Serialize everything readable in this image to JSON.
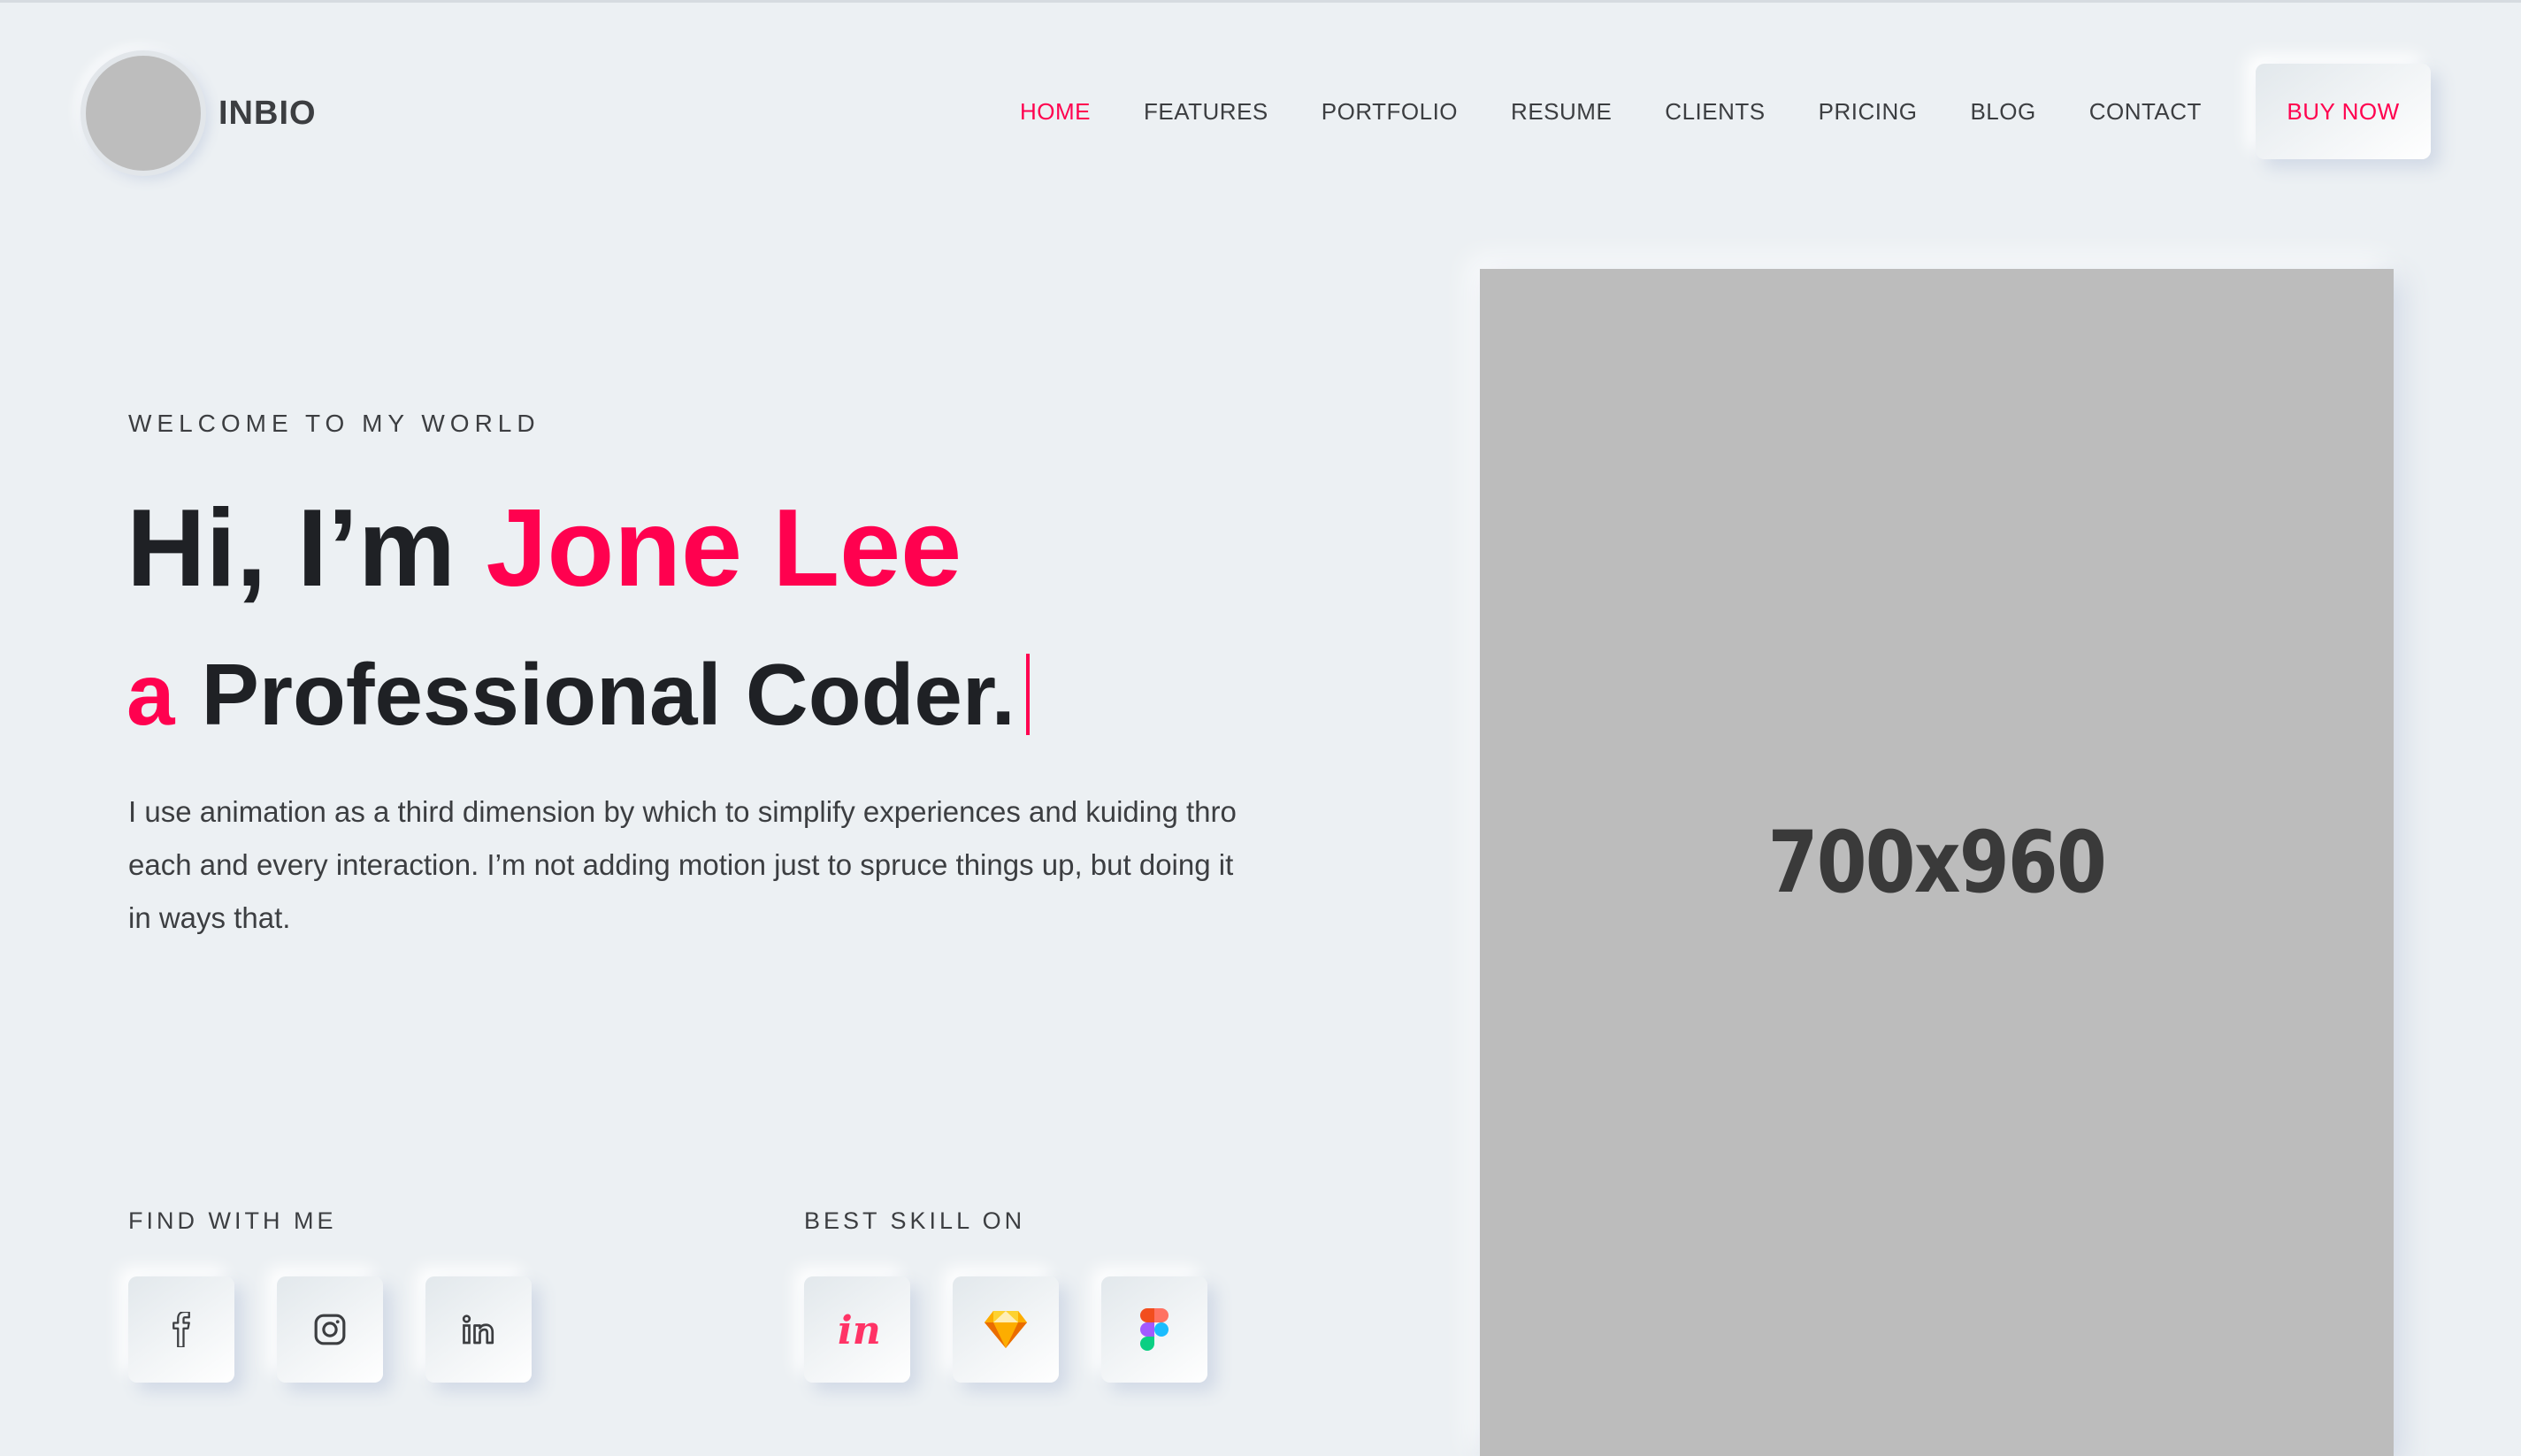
{
  "brand": {
    "name": "INBIO"
  },
  "nav": {
    "items": [
      {
        "label": "HOME",
        "active": true
      },
      {
        "label": "FEATURES"
      },
      {
        "label": "PORTFOLIO"
      },
      {
        "label": "RESUME"
      },
      {
        "label": "CLIENTS"
      },
      {
        "label": "PRICING"
      },
      {
        "label": "BLOG"
      },
      {
        "label": "CONTACT"
      }
    ],
    "cta_label": "BUY NOW"
  },
  "hero": {
    "welcome": "WELCOME TO MY WORLD",
    "greeting": "Hi, I’m ",
    "name": "Jone Lee",
    "sub_prefix": "a",
    "sub_text": "Professional Coder.",
    "description": "I use animation as a third dimension by which to simplify experiences and kuiding thro each and every interaction. I’m not adding motion just to spruce things up, but doing it in ways that."
  },
  "social": {
    "label": "FIND WITH ME",
    "icons": [
      "facebook-icon",
      "instagram-icon",
      "linkedin-icon"
    ]
  },
  "skills": {
    "label": "BEST SKILL ON",
    "icons": [
      "invision-icon",
      "sketch-icon",
      "figma-icon"
    ]
  },
  "image": {
    "placeholder_text": "700x960"
  },
  "colors": {
    "background": "#ECF0F3",
    "accent": "#ff014f",
    "text_dark": "#1f2125",
    "text_body": "#3c3e41",
    "placeholder": "#bcbcbc"
  }
}
